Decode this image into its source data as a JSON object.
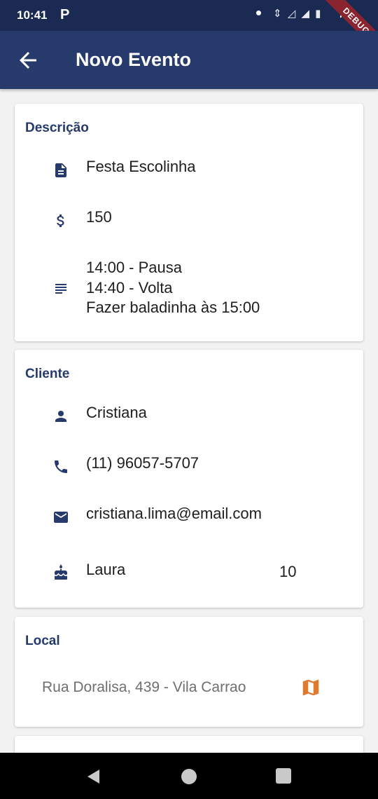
{
  "status_bar": {
    "time": "10:41",
    "notification_letter": "P",
    "battery": "75%"
  },
  "app_bar": {
    "title": "Novo Evento",
    "back_icon": "arrow-left-icon"
  },
  "debug_banner": "DEBUG",
  "descricao": {
    "title": "Descrição",
    "name": "Festa Escolinha",
    "price": "150",
    "notes": [
      "14:00 - Pausa",
      "14:40 - Volta",
      "Fazer baladinha às 15:00"
    ],
    "icons": [
      "document-icon",
      "dollar-icon",
      "notes-icon"
    ]
  },
  "cliente": {
    "title": "Cliente",
    "name": "Cristiana",
    "phone": "(11) 96057-5707",
    "email": "cristiana.lima@email.com",
    "birthday_name": "Laura",
    "birthday_age": "10",
    "icons": [
      "person-icon",
      "phone-icon",
      "email-icon",
      "cake-icon"
    ]
  },
  "local": {
    "title": "Local",
    "address": "Rua Doralisa, 439 - Vila Carrao",
    "map_icon": "map-icon"
  },
  "colors": {
    "status_bar": "#1b2a52",
    "app_bar": "#263a6c",
    "accent_text": "#263a6c",
    "map_icon": "#e07a2e",
    "background": "#f2f2f2"
  }
}
